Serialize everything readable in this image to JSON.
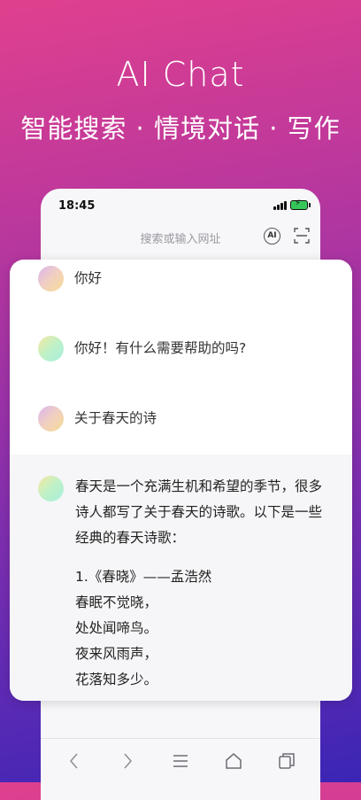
{
  "hero": {
    "title": "AI Chat",
    "subtitle": "智能搜索 · 情境对话 · 写作"
  },
  "status_bar": {
    "time": "18:45",
    "battery_color": "#35c759"
  },
  "url_bar": {
    "placeholder": "搜索或输入网址",
    "ai_button_label": "AI"
  },
  "chat": {
    "messages": [
      {
        "role": "user",
        "text": "你好"
      },
      {
        "role": "ai",
        "text": "你好！有什么需要帮助的吗?"
      },
      {
        "role": "user",
        "text": "关于春天的诗"
      }
    ],
    "reply": {
      "intro": "春天是一个充满生机和希望的季节，很多诗人都写了关于春天的诗歌。以下是一些经典的春天诗歌：",
      "poem_lines": [
        "1.《春晓》——孟浩然",
        "春眠不觉晓，",
        "处处闻啼鸟。",
        "夜来风雨声，",
        "花落知多少。"
      ]
    }
  },
  "bottom_nav": {
    "icons": [
      "back-icon",
      "forward-icon",
      "menu-icon",
      "home-icon",
      "tabs-icon"
    ]
  }
}
